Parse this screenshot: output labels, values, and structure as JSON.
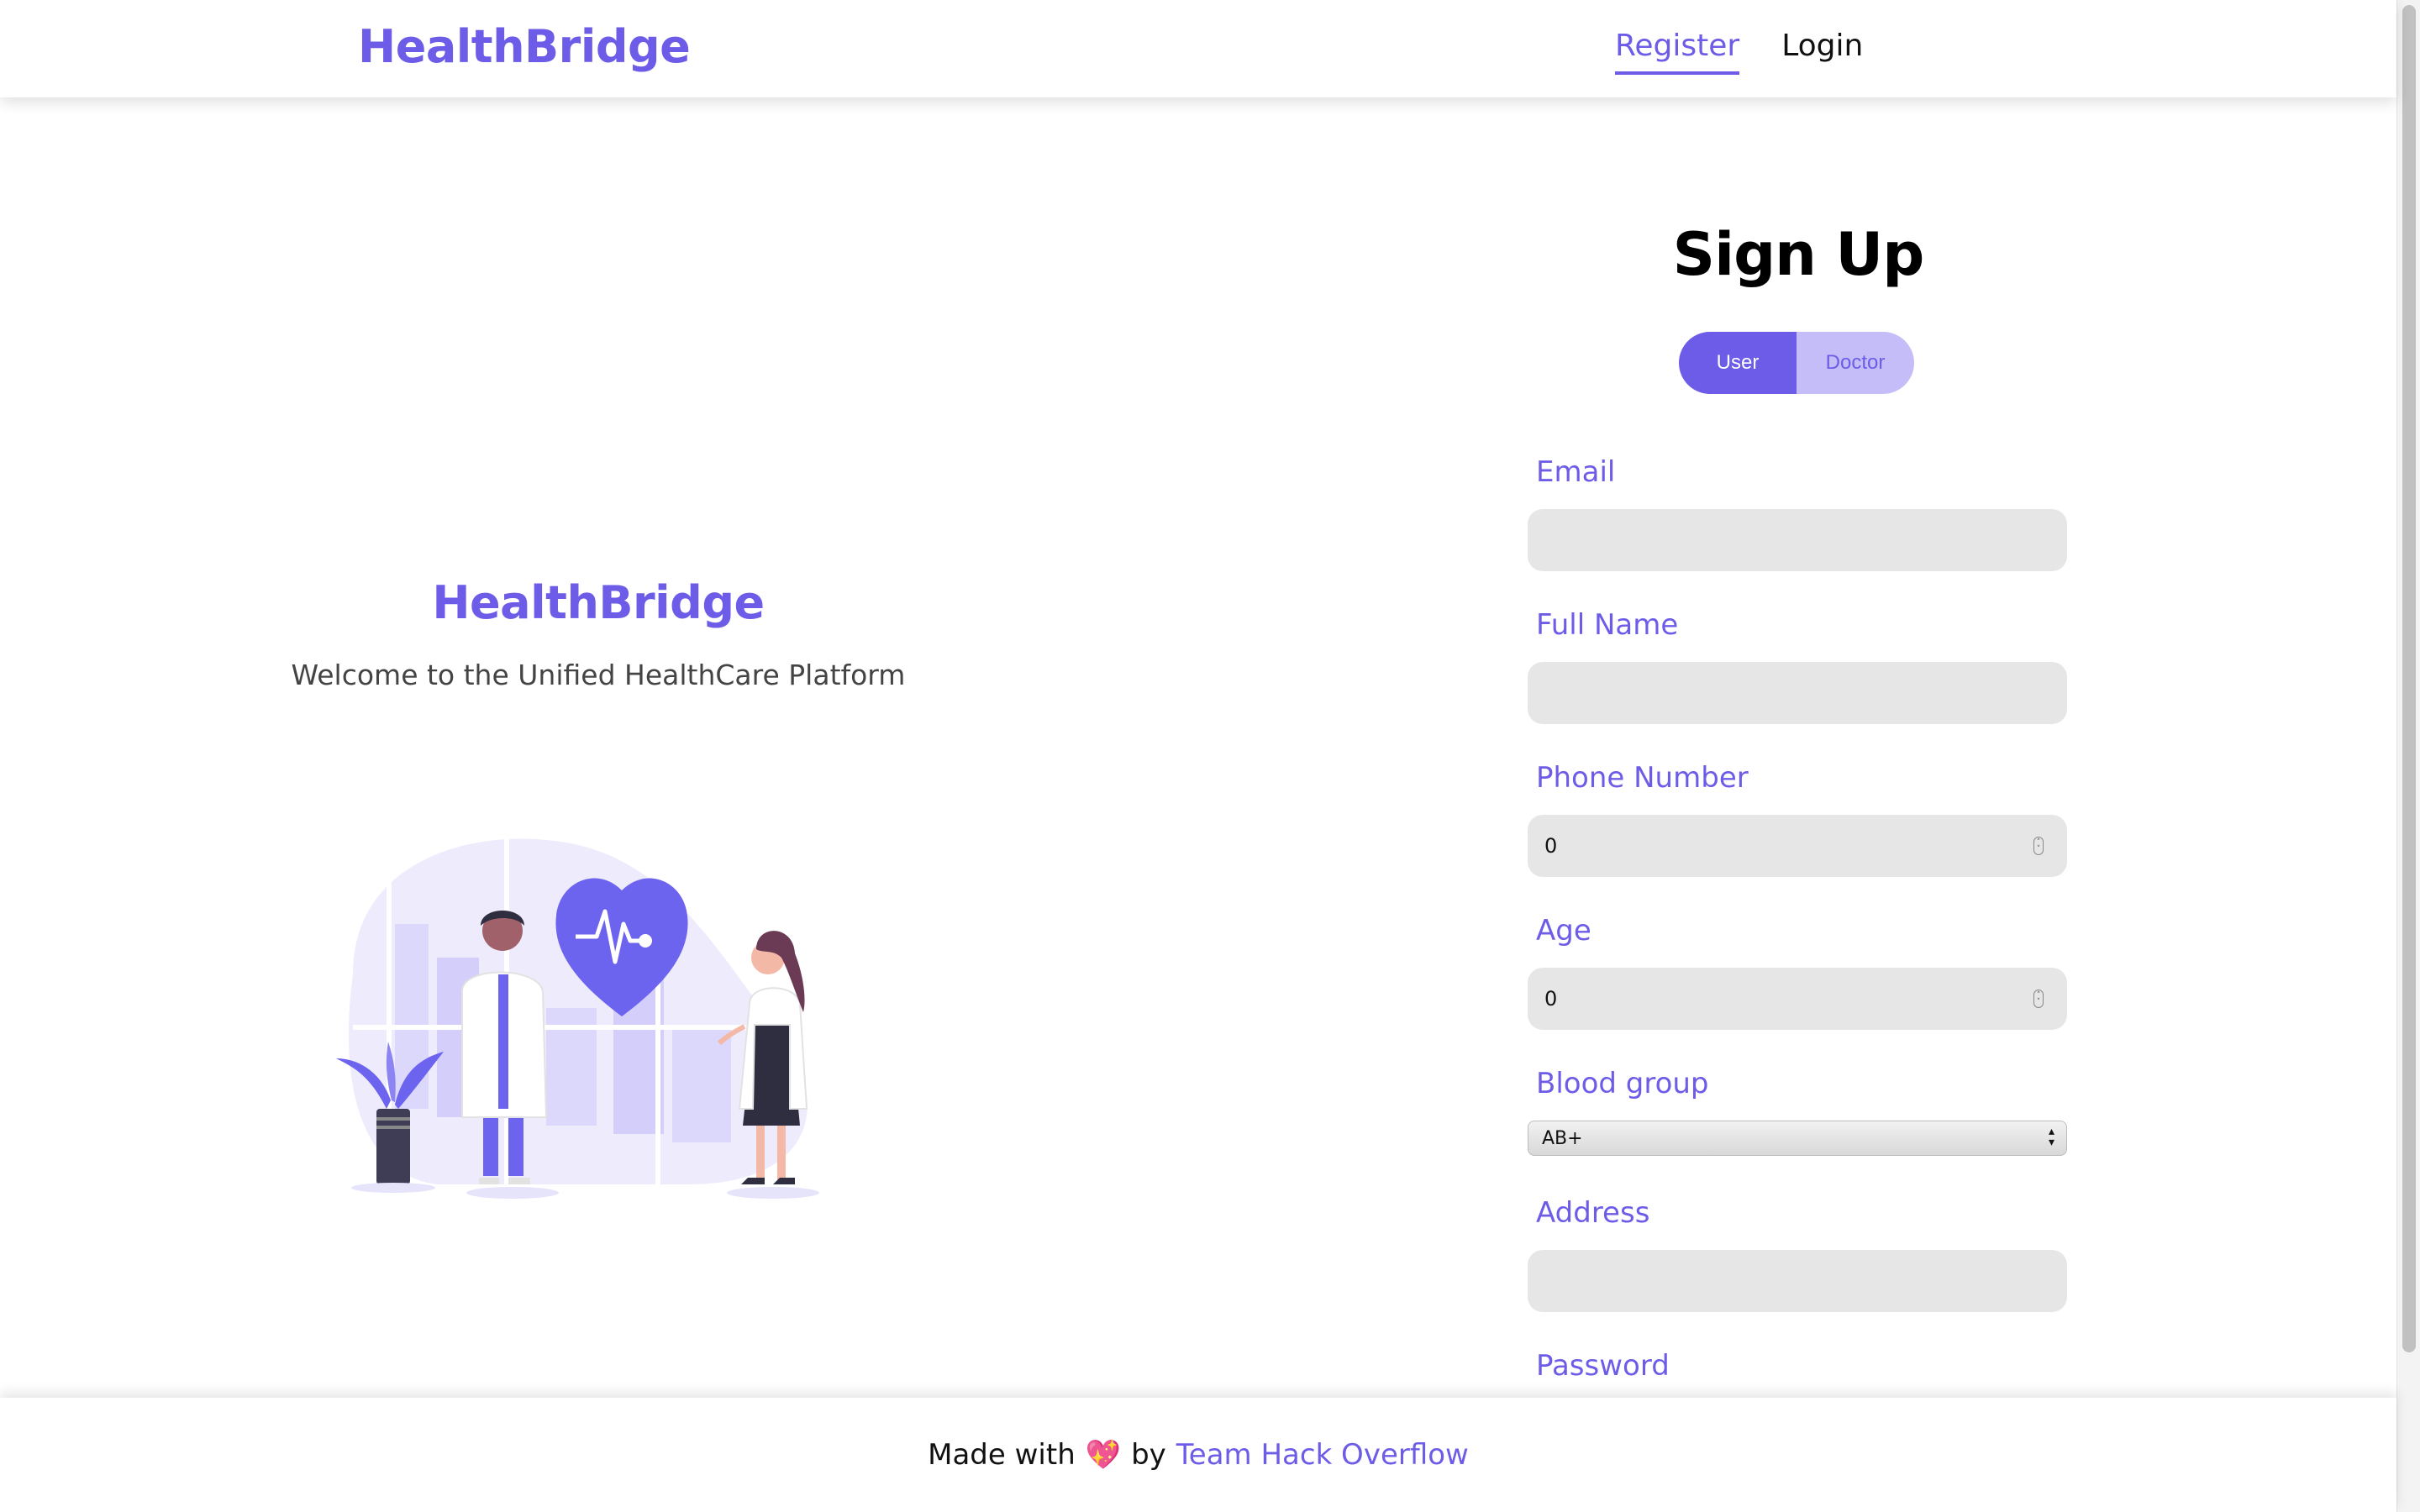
{
  "navbar": {
    "brand": "HealthBridge",
    "links": [
      {
        "label": "Register",
        "active": true
      },
      {
        "label": "Login",
        "active": false
      }
    ]
  },
  "hero": {
    "title": "HealthBridge",
    "subtitle": "Welcome to the Unified HealthCare Platform"
  },
  "signup": {
    "title": "Sign Up",
    "roles": {
      "user": "User",
      "doctor": "Doctor",
      "selected": "User"
    },
    "fields": {
      "email": {
        "label": "Email",
        "value": ""
      },
      "full_name": {
        "label": "Full Name",
        "value": ""
      },
      "phone": {
        "label": "Phone Number",
        "value": "0"
      },
      "age": {
        "label": "Age",
        "value": "0"
      },
      "blood_group": {
        "label": "Blood group",
        "value": "AB+"
      },
      "address": {
        "label": "Address",
        "value": ""
      },
      "password": {
        "label": "Password",
        "value": ""
      }
    }
  },
  "footer": {
    "made_with": "Made with",
    "by": "by",
    "team": "Team Hack Overflow",
    "heart_icon": "sparkling-heart-icon"
  },
  "colors": {
    "accent": "#6c5ce7",
    "accent_light": "#c4bdf7",
    "input_bg": "#e6e6e6"
  }
}
